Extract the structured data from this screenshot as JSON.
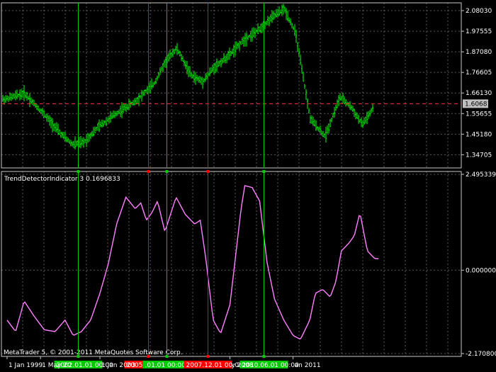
{
  "app": {
    "copyright": "MetaTrader 5, © 2001-2011 MetaQuotes Software Corp."
  },
  "colors": {
    "background": "#000000",
    "grid": "#5a5a5a",
    "frame": "#c8c8c8",
    "bull_bar": "#00ff00",
    "price_line": "#ff3030",
    "indicator": "#ff80ff",
    "buy_marker": "#00cc00",
    "sell_marker": "#ff0000",
    "current_price_bg": "#c0c0c0"
  },
  "chart_data": [
    {
      "type": "bar",
      "panel": "price",
      "title": "",
      "current_price": "1.60681",
      "ylim": [
        1.28,
        2.12
      ],
      "y_ticks": [
        "2.08030",
        "1.97555",
        "1.87080",
        "1.76605",
        "1.66130",
        "1.55655",
        "1.45180",
        "1.34705"
      ],
      "y_tick_values": [
        2.0803,
        1.97555,
        1.8708,
        1.76605,
        1.6613,
        1.55655,
        1.4518,
        1.34705
      ],
      "series": [
        {
          "t": [
            0.0,
            0.05,
            0.1,
            0.15,
            0.18,
            0.21,
            0.25,
            0.3,
            0.35,
            0.4,
            0.43,
            0.46,
            0.5,
            0.53,
            0.56,
            0.6,
            0.64,
            0.68,
            0.72,
            0.75,
            0.78,
            0.82,
            0.86,
            0.9,
            0.93,
            0.96,
            1.0
          ],
          "v": [
            1.63,
            1.66,
            1.56,
            1.45,
            1.4,
            1.41,
            1.49,
            1.56,
            1.62,
            1.71,
            1.82,
            1.89,
            1.75,
            1.72,
            1.79,
            1.85,
            1.93,
            1.98,
            2.05,
            2.09,
            1.97,
            1.53,
            1.44,
            1.64,
            1.59,
            1.5,
            1.61
          ]
        }
      ]
    },
    {
      "type": "line",
      "panel": "indicator",
      "title": "TrendDetectorIndicator 3 0.1696833",
      "ylim": [
        -2.1708004,
        2.4953394
      ],
      "y_ticks": [
        "2.4953394",
        "0.000000",
        "-2.1708004"
      ],
      "y_tick_values": [
        2.4953394,
        0.0,
        -2.1708004
      ],
      "series": [
        {
          "name": "TrendDetectorIndicator",
          "t": [
            0.0,
            0.023,
            0.046,
            0.073,
            0.1,
            0.129,
            0.156,
            0.178,
            0.2,
            0.225,
            0.25,
            0.272,
            0.295,
            0.32,
            0.345,
            0.36,
            0.375,
            0.39,
            0.405,
            0.425,
            0.455,
            0.48,
            0.505,
            0.52,
            0.535,
            0.555,
            0.575,
            0.6,
            0.63,
            0.64,
            0.66,
            0.68,
            0.7,
            0.72,
            0.745,
            0.77,
            0.79,
            0.815,
            0.83,
            0.85,
            0.87,
            0.885,
            0.9,
            0.92,
            0.935,
            0.95,
            0.97,
            0.99
          ],
          "v": [
            -1.3,
            -1.6,
            -0.8,
            -1.2,
            -1.55,
            -1.6,
            -1.3,
            -1.7,
            -1.6,
            -1.3,
            -0.6,
            0.15,
            1.2,
            1.9,
            1.6,
            1.75,
            1.3,
            1.5,
            1.8,
            1.0,
            1.9,
            1.45,
            1.2,
            1.3,
            0.3,
            -1.3,
            -1.65,
            -0.9,
            1.6,
            2.2,
            2.15,
            1.8,
            0.2,
            -0.75,
            -1.3,
            -1.7,
            -1.8,
            -1.3,
            -0.6,
            -0.5,
            -0.7,
            -0.3,
            0.5,
            0.7,
            0.9,
            1.5,
            0.5,
            0.3
          ]
        }
      ]
    }
  ],
  "signals": [
    {
      "t": 0.19,
      "type": "buy",
      "label": "2002.01.01 00:00"
    },
    {
      "t": 0.38,
      "type": "sell",
      "label": "2005.04.01 00:00"
    },
    {
      "t": 0.43,
      "type": "buy",
      "label": ".01.01 00:00"
    },
    {
      "t": 0.54,
      "type": "sell",
      "label": "2007.12.01 00:00"
    },
    {
      "t": 0.69,
      "type": "buy",
      "label": "2010.06.01 00:00"
    }
  ],
  "x_axis": {
    "labels": [
      {
        "t": 0.0,
        "text": "1 Jan 1999"
      },
      {
        "t": 0.09,
        "text": "1 May 20"
      },
      {
        "t": 0.25,
        "text": "1 Jan 2003"
      },
      {
        "t": 0.6,
        "text": "y 2008"
      },
      {
        "t": 0.77,
        "text": "an 2011"
      }
    ]
  }
}
